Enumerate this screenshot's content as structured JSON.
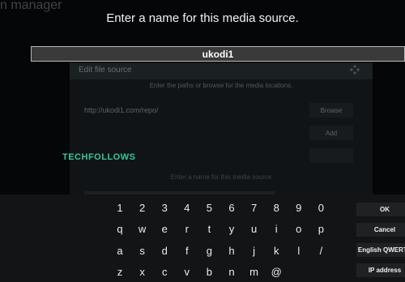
{
  "background": {
    "title": "n manager",
    "items": [
      "",
      "",
      "",
      "",
      "",
      ""
    ]
  },
  "dialog": {
    "title": "Edit file source",
    "instruction": "Enter the paths or browse for the media locations.",
    "path": "http://ukodi1.com/repo/",
    "browse_label": "Browse",
    "add_label": "Add",
    "hint": "Enter a name for this media source"
  },
  "prompt": {
    "title": "Enter a name for this media source.",
    "value": "ukodi1"
  },
  "watermark": "TECHFOLLOWS",
  "keyboard": {
    "rows": [
      [
        "1",
        "2",
        "3",
        "4",
        "5",
        "6",
        "7",
        "8",
        "9",
        "0"
      ],
      [
        "q",
        "w",
        "e",
        "r",
        "t",
        "y",
        "u",
        "i",
        "o",
        "p"
      ],
      [
        "a",
        "s",
        "d",
        "f",
        "g",
        "h",
        "j",
        "k",
        "l",
        "/"
      ],
      [
        "z",
        "x",
        "c",
        "v",
        "b",
        "n",
        "m",
        "@",
        "",
        ""
      ]
    ],
    "side_buttons": [
      "OK",
      "Cancel",
      "English QWERTY",
      "IP address"
    ]
  }
}
